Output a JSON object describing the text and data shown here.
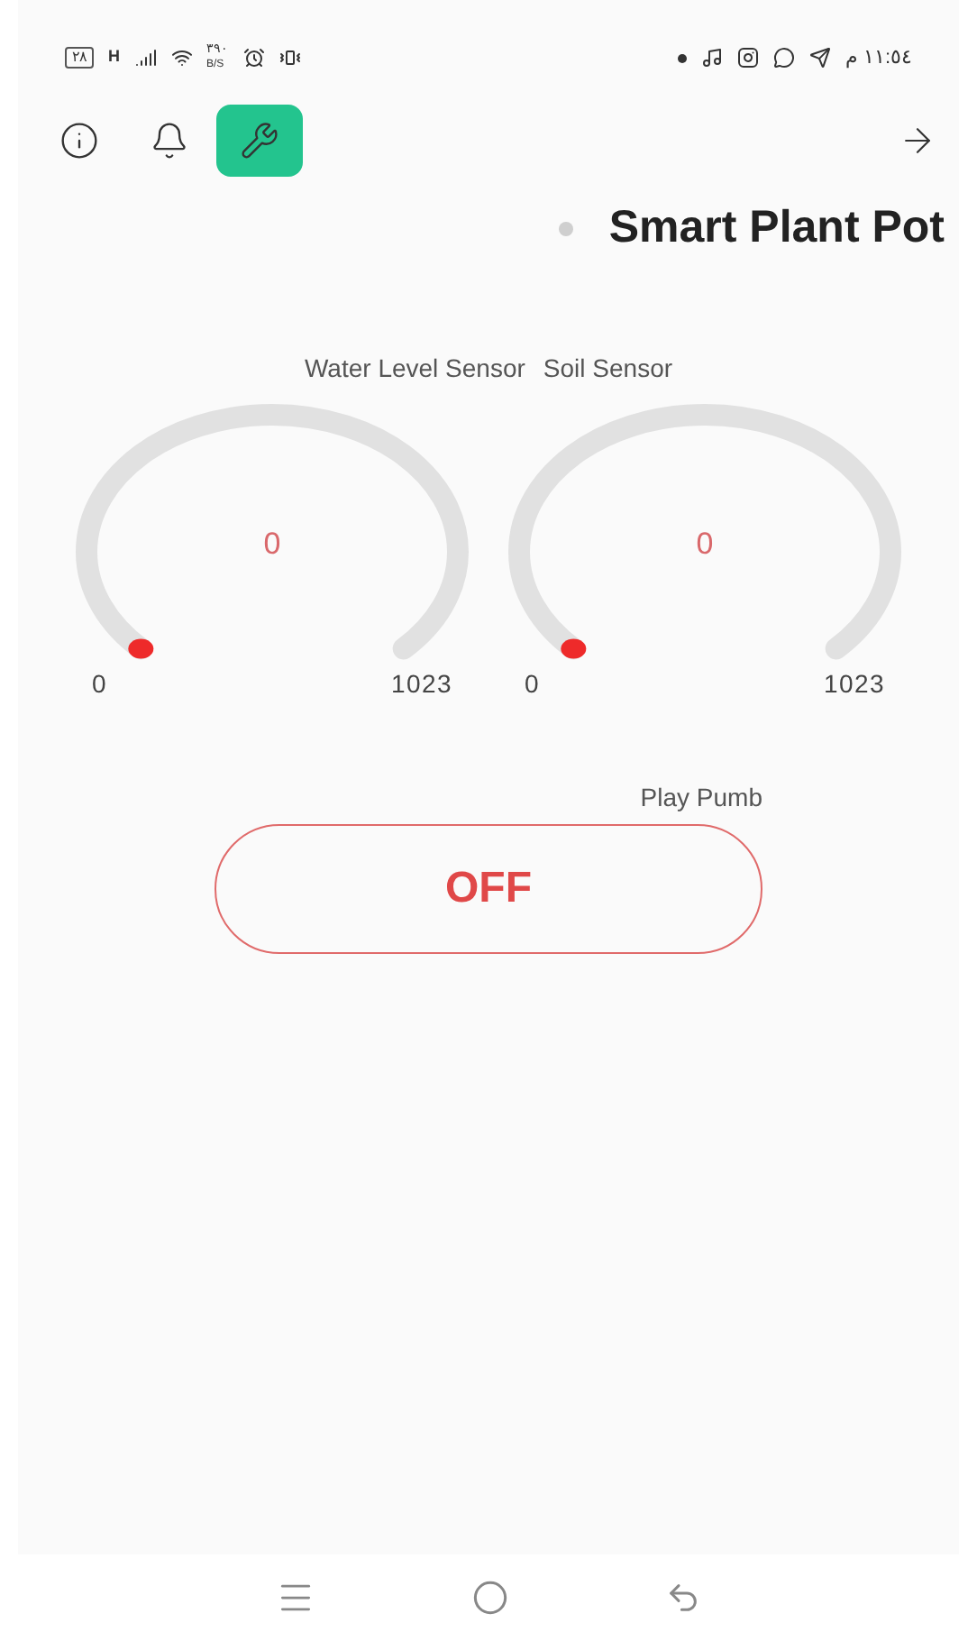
{
  "status_bar": {
    "battery": "٢٨",
    "network": "H",
    "speed_value": "٣٩٠",
    "speed_unit": "B/S",
    "time": "١١:٥٤ م"
  },
  "toolbar": {
    "items": [
      {
        "kind": "info",
        "selected": false
      },
      {
        "kind": "bell",
        "selected": false
      },
      {
        "kind": "wrench",
        "selected": true
      }
    ]
  },
  "title": "Smart Plant Pot",
  "gauges": [
    {
      "label": "Water Level Sensor",
      "value": "0",
      "min": "0",
      "max": "1023"
    },
    {
      "label": "Soil Sensor",
      "value": "0",
      "min": "0",
      "max": "1023"
    }
  ],
  "pump": {
    "label": "Play Pumb",
    "state": "OFF",
    "on": false
  }
}
